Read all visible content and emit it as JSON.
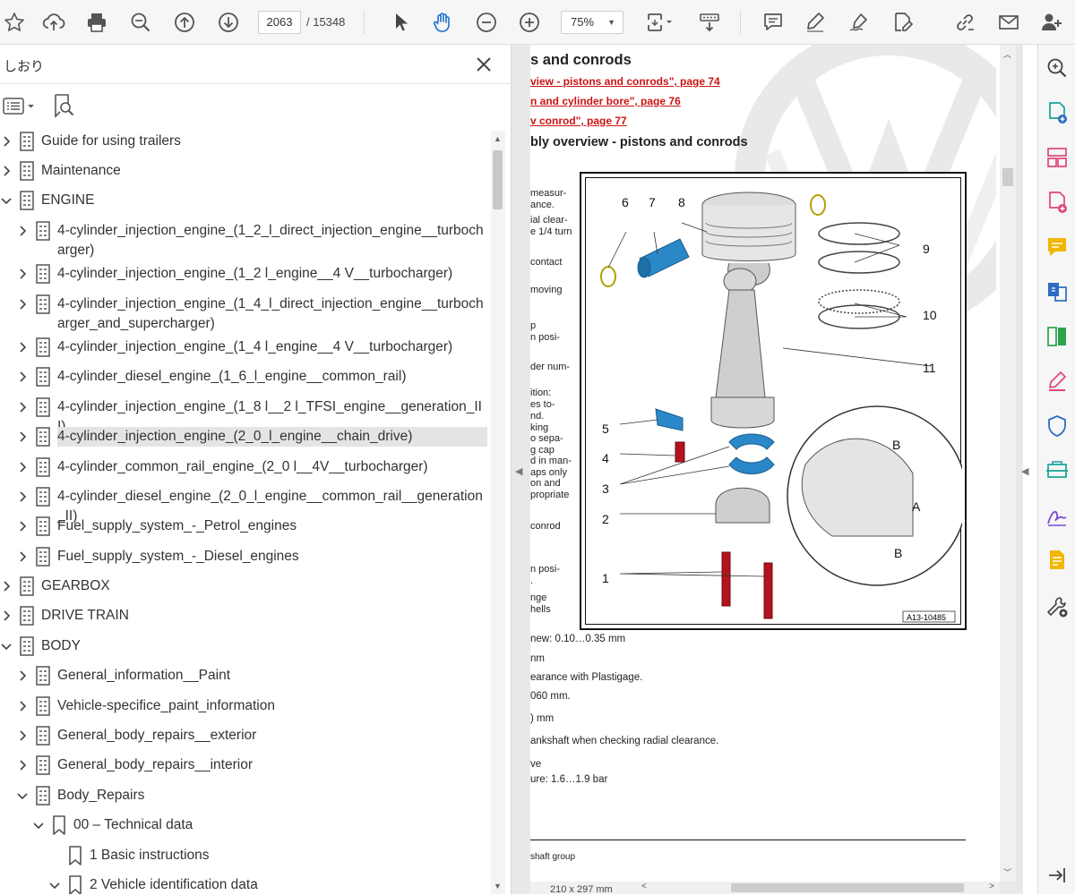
{
  "toolbar": {
    "current_page": "2063",
    "total_pages": "/ 15348",
    "zoom": "75%",
    "icons": [
      "bookmark-star-icon",
      "upload-cloud-icon",
      "print-icon",
      "zoom-search-icon",
      "page-up-icon",
      "page-down-icon",
      "select-arrow-icon",
      "hand-tool-icon",
      "zoom-out-icon",
      "zoom-in-icon",
      "page-fit-icon",
      "scroll-mode-icon",
      "comment-icon",
      "highlight-icon",
      "sign-icon",
      "edit-pdf-icon",
      "link-icon",
      "email-icon",
      "share-user-icon"
    ]
  },
  "bookmarks": {
    "title": "しおり",
    "items": [
      {
        "label": "Guide for using trailers",
        "indent": 0,
        "expanded": false,
        "icon": "bookmark-tree-icon"
      },
      {
        "label": "Maintenance",
        "indent": 0,
        "expanded": false,
        "icon": "bookmark-tree-icon"
      },
      {
        "label": "ENGINE",
        "indent": 0,
        "expanded": true,
        "icon": "bookmark-tree-icon"
      },
      {
        "label": "4-cylinder_injection_engine_(1_2_l_direct_injection_engine__turbocharger)",
        "indent": 1,
        "expanded": false,
        "icon": "bookmark-tree-icon"
      },
      {
        "label": "4-cylinder_injection_engine_(1_2 l_engine__4 V__turbocharger)",
        "indent": 1,
        "expanded": false,
        "icon": "bookmark-tree-icon"
      },
      {
        "label": "4-cylinder_injection_engine_(1_4_l_direct_injection_engine__turbocharger_and_supercharger)",
        "indent": 1,
        "expanded": false,
        "icon": "bookmark-tree-icon"
      },
      {
        "label": "4-cylinder_injection_engine_(1_4 l_engine__4 V__turbocharger)",
        "indent": 1,
        "expanded": false,
        "icon": "bookmark-tree-icon"
      },
      {
        "label": "4-cylinder_diesel_engine_(1_6_l_engine__common_rail)",
        "indent": 1,
        "expanded": false,
        "icon": "bookmark-tree-icon"
      },
      {
        "label": "4-cylinder_injection_engine_(1_8 l__2 l_TFSI_engine__generation_III)",
        "indent": 1,
        "expanded": false,
        "icon": "bookmark-tree-icon"
      },
      {
        "label": "4-cylinder_injection_engine_(2_0_l_engine__chain_drive)",
        "indent": 1,
        "expanded": false,
        "icon": "bookmark-tree-icon",
        "selected": true
      },
      {
        "label": "4-cylinder_common_rail_engine_(2_0 l__4V__turbocharger)",
        "indent": 1,
        "expanded": false,
        "icon": "bookmark-tree-icon"
      },
      {
        "label": "4-cylinder_diesel_engine_(2_0_l_engine__common_rail__generation_II)",
        "indent": 1,
        "expanded": false,
        "icon": "bookmark-tree-icon"
      },
      {
        "label": "Fuel_supply_system_-_Petrol_engines",
        "indent": 1,
        "expanded": false,
        "icon": "bookmark-tree-icon"
      },
      {
        "label": "Fuel_supply_system_-_Diesel_engines",
        "indent": 1,
        "expanded": false,
        "icon": "bookmark-tree-icon"
      },
      {
        "label": "GEARBOX",
        "indent": 0,
        "expanded": false,
        "icon": "bookmark-tree-icon"
      },
      {
        "label": "DRIVE TRAIN",
        "indent": 0,
        "expanded": false,
        "icon": "bookmark-tree-icon"
      },
      {
        "label": "BODY",
        "indent": 0,
        "expanded": true,
        "icon": "bookmark-tree-icon"
      },
      {
        "label": "General_information__Paint",
        "indent": 1,
        "expanded": false,
        "icon": "bookmark-tree-icon"
      },
      {
        "label": "Vehicle-specifice_paint_information",
        "indent": 1,
        "expanded": false,
        "icon": "bookmark-tree-icon"
      },
      {
        "label": "General_body_repairs__exterior",
        "indent": 1,
        "expanded": false,
        "icon": "bookmark-tree-icon"
      },
      {
        "label": "General_body_repairs__interior",
        "indent": 1,
        "expanded": false,
        "icon": "bookmark-tree-icon"
      },
      {
        "label": "Body_Repairs",
        "indent": 1,
        "expanded": true,
        "icon": "bookmark-tree-icon"
      },
      {
        "label": "00 – Technical data",
        "indent": 2,
        "expanded": true,
        "icon": "bookmark-ribbon-icon"
      },
      {
        "label": "1 Basic instructions",
        "indent": 3,
        "expanded": null,
        "icon": "bookmark-ribbon-icon"
      },
      {
        "label": "2 Vehicle identification data",
        "indent": 3,
        "expanded": true,
        "icon": "bookmark-ribbon-icon"
      }
    ]
  },
  "document": {
    "heading": "s and conrods",
    "links": [
      "view - pistons and conrods\", page 74",
      "n and cylinder bore\", page 76",
      "v conrod\", page 77"
    ],
    "subheading": "bly overview - pistons and conrods",
    "left_notes": [
      "measur-",
      "ance.",
      "ial clear-",
      "e 1/4 turn",
      "contact",
      "moving",
      "p",
      "n posi-",
      "der num-",
      "ition:",
      "es to-",
      "nd.",
      "king",
      "o sepa-",
      "g cap",
      "d in man-",
      "aps only",
      "on and",
      "propriate",
      "conrod",
      "n posi-",
      ".",
      "nge",
      "hells"
    ],
    "figure_id": "A13-10485",
    "callouts": [
      "6",
      "7",
      "8",
      "9",
      "10",
      "11",
      "5",
      "4",
      "3",
      "2",
      "1",
      "B",
      "A",
      "B"
    ],
    "lines_below": [
      "new: 0.10…0.35 mm",
      "nm",
      "earance with Plastigage.",
      "060 mm.",
      ") mm",
      "ankshaft when checking radial clearance.",
      "ve",
      "ure: 1.6…1.9 bar"
    ],
    "footer": "shaft group",
    "page_size": "210 x 297 mm"
  },
  "tool_rail": {
    "icons": [
      "zoom-search-icon",
      "create-pdf-icon",
      "organize-pages-icon",
      "export-pdf-icon",
      "comment-tool-icon",
      "combine-files-icon",
      "compare-icon",
      "fill-sign-icon",
      "protect-icon",
      "scan-icon",
      "request-signature-icon",
      "send-review-icon",
      "more-tools-icon"
    ]
  },
  "colors": {
    "link_red": "#cc1414",
    "tool_blue": "#2d6bc4",
    "tool_pink": "#e0457b",
    "tool_yellow": "#f2b600",
    "tool_green": "#2ba34a",
    "tool_purple": "#7a4bd1",
    "tool_teal": "#16a394",
    "part_blue": "#2b88c8",
    "part_red": "#b3121f"
  }
}
